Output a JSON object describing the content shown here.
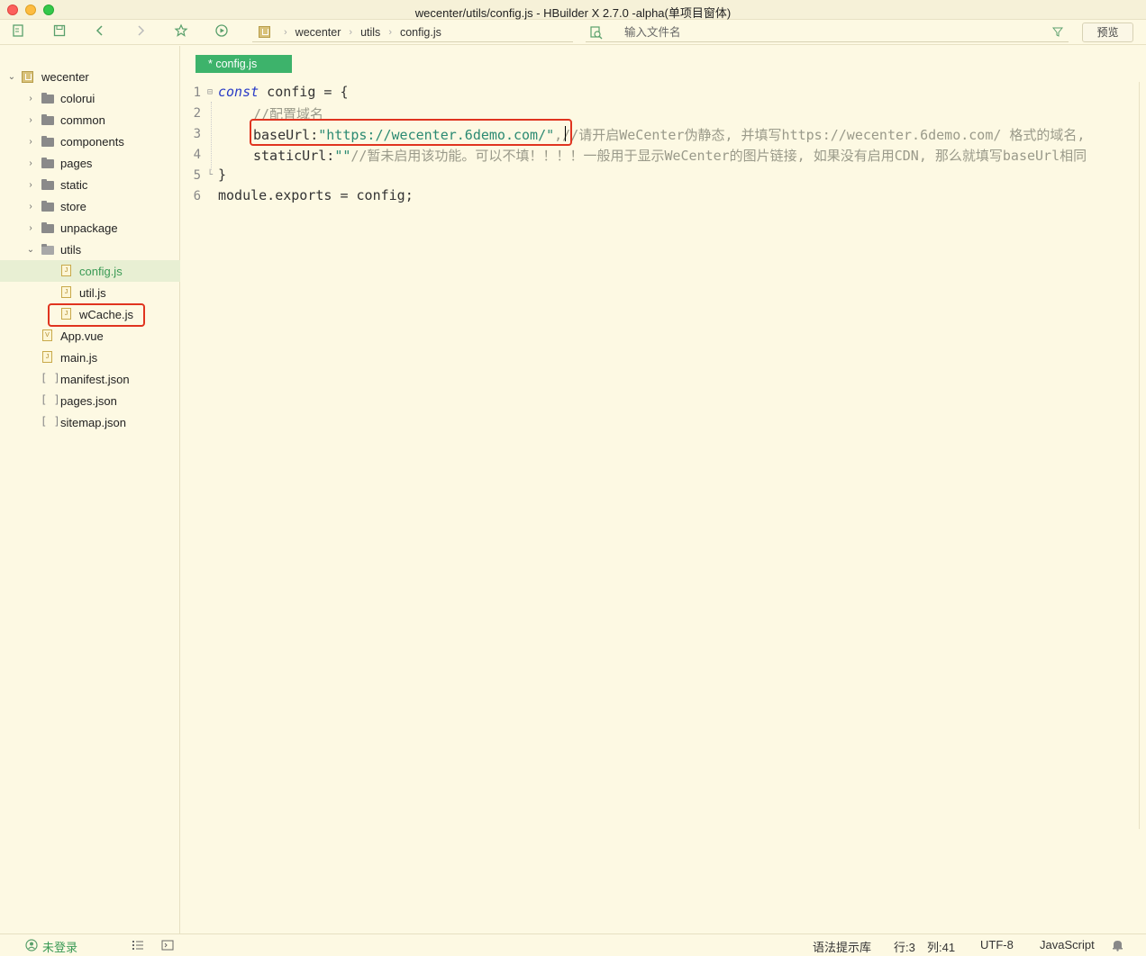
{
  "window": {
    "title": "wecenter/utils/config.js - HBuilder X 2.7.0 -alpha(单项目窗体)"
  },
  "toolbar": {
    "breadcrumb": [
      "wecenter",
      "utils",
      "config.js"
    ],
    "file_search_placeholder": "输入文件名",
    "preview_label": "预览"
  },
  "sidebar": {
    "project": "wecenter",
    "items": [
      {
        "label": "colorui",
        "type": "folder"
      },
      {
        "label": "common",
        "type": "folder"
      },
      {
        "label": "components",
        "type": "folder"
      },
      {
        "label": "pages",
        "type": "folder"
      },
      {
        "label": "static",
        "type": "folder"
      },
      {
        "label": "store",
        "type": "folder"
      },
      {
        "label": "unpackage",
        "type": "folder"
      },
      {
        "label": "utils",
        "type": "folder-open"
      },
      {
        "label": "config.js",
        "type": "file",
        "selected": true
      },
      {
        "label": "util.js",
        "type": "file"
      },
      {
        "label": "wCache.js",
        "type": "file"
      },
      {
        "label": "App.vue",
        "type": "vue"
      },
      {
        "label": "main.js",
        "type": "file"
      },
      {
        "label": "manifest.json",
        "type": "json"
      },
      {
        "label": "pages.json",
        "type": "json"
      },
      {
        "label": "sitemap.json",
        "type": "json"
      }
    ]
  },
  "editor": {
    "tab_label": "* config.js",
    "line_numbers": [
      "1",
      "2",
      "3",
      "4",
      "5",
      "6"
    ],
    "lines": {
      "l1_kw": "const",
      "l1_rest": " config = {",
      "l2_comment": "//配置域名",
      "l3_key": "baseUrl:",
      "l3_str": "\"https://wecenter.6demo.com/\"",
      "l3_comment": ",//请开启WeCenter伪静态, 并填写https://wecenter.6demo.com/ 格式的域名,",
      "l4_key": "staticUrl:",
      "l4_str": "\"\"",
      "l4_comment": "//暂未启用该功能。可以不填！！！！一般用于显示WeCenter的图片链接, 如果没有启用CDN, 那么就填写baseUrl相同",
      "l5": "}",
      "l6": "module.exports = config;"
    }
  },
  "statusbar": {
    "login": "未登录",
    "syntax_lib": "语法提示库",
    "row": "行:3",
    "col": "列:41",
    "encoding": "UTF-8",
    "language": "JavaScript"
  },
  "colors": {
    "accent": "#3db36b",
    "highlight_box": "#e0341f",
    "background": "#fdf9e3"
  }
}
